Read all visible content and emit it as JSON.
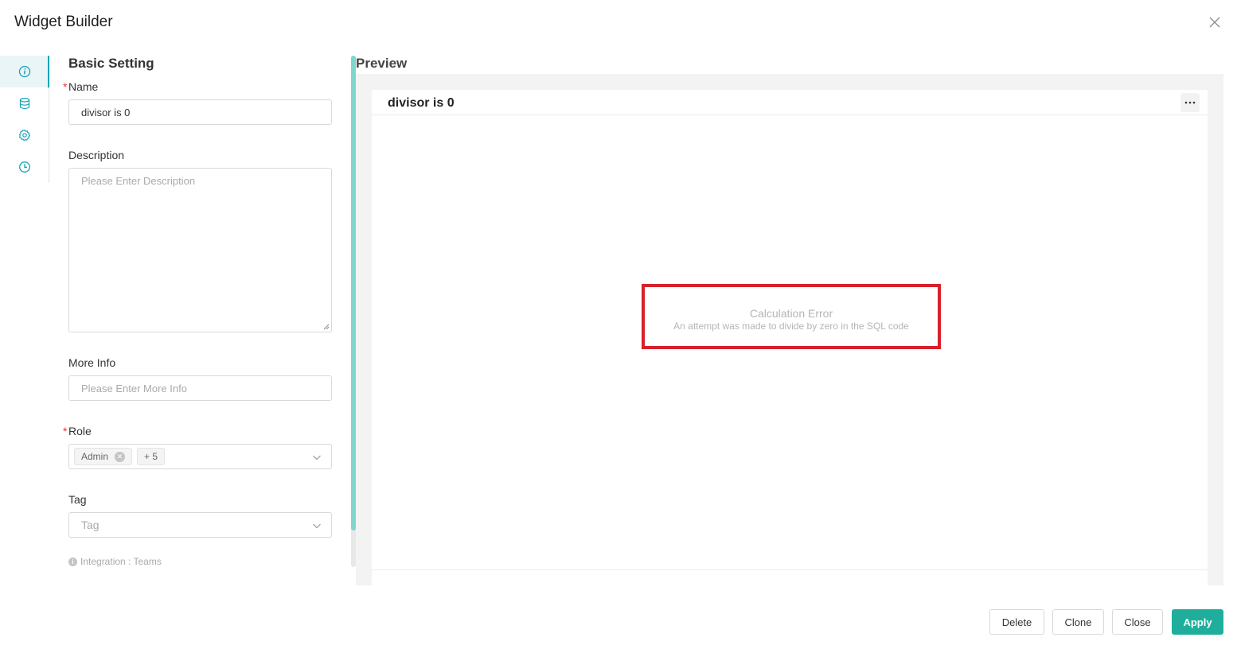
{
  "window": {
    "title": "Widget Builder"
  },
  "rail": {
    "icons": [
      "info-icon",
      "database-icon",
      "gear-icon",
      "clock-icon"
    ]
  },
  "form": {
    "section_title": "Basic Setting",
    "required_mark": "*",
    "name_label": "Name",
    "name_value": "divisor is 0",
    "description_label": "Description",
    "description_placeholder": "Please Enter Description",
    "more_info_label": "More Info",
    "more_info_placeholder": "Please Enter More Info",
    "role_label": "Role",
    "role_tags": [
      "Admin"
    ],
    "role_more": "+ 5",
    "tag_label": "Tag",
    "tag_placeholder": "Tag",
    "hint_text": "Integration : Teams"
  },
  "preview": {
    "title": "Preview",
    "widget_title": "divisor is 0",
    "error_title": "Calculation Error",
    "error_message": "An attempt was made to divide by zero in the SQL code"
  },
  "footer": {
    "delete_label": "Delete",
    "clone_label": "Clone",
    "close_label": "Close",
    "apply_label": "Apply"
  },
  "colors": {
    "accent": "#17a2b8",
    "primary_button": "#1fae9b",
    "error_border": "#d9202a",
    "required": "#e0363c"
  }
}
